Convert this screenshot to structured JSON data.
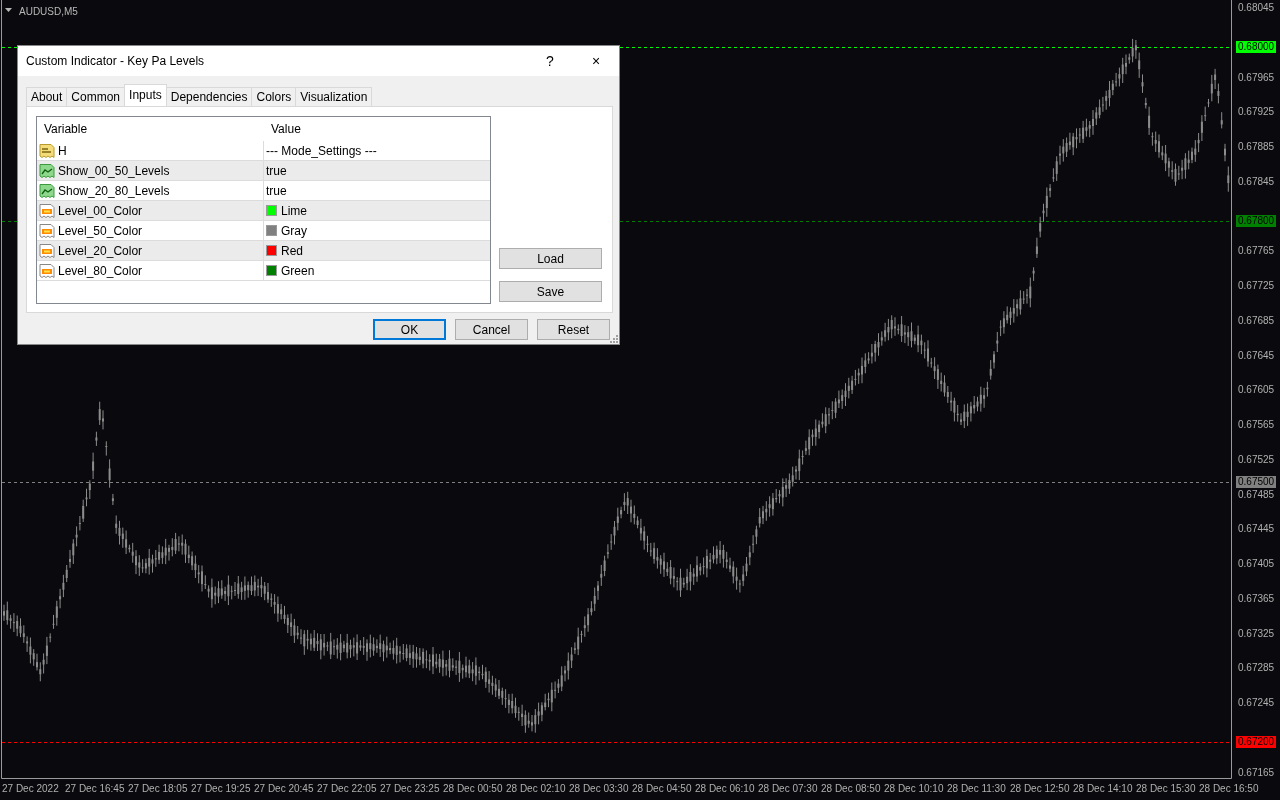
{
  "chart": {
    "symbol": "AUDUSD,M5",
    "price_axis": [
      {
        "label": "0.68045",
        "kind": "tick"
      },
      {
        "label": "0.68000",
        "kind": "level",
        "color": "#00ff00"
      },
      {
        "label": "0.67965",
        "kind": "tick"
      },
      {
        "label": "0.67925",
        "kind": "tick"
      },
      {
        "label": "0.67885",
        "kind": "tick"
      },
      {
        "label": "0.67845",
        "kind": "tick"
      },
      {
        "label": "0.67800",
        "kind": "level",
        "color": "#008000"
      },
      {
        "label": "0.67765",
        "kind": "tick"
      },
      {
        "label": "0.67725",
        "kind": "tick"
      },
      {
        "label": "0.67685",
        "kind": "tick"
      },
      {
        "label": "0.67645",
        "kind": "tick"
      },
      {
        "label": "0.67605",
        "kind": "tick"
      },
      {
        "label": "0.67565",
        "kind": "tick"
      },
      {
        "label": "0.67525",
        "kind": "tick"
      },
      {
        "label": "0.67500",
        "kind": "level",
        "color": "#808080"
      },
      {
        "label": "0.67485",
        "kind": "tick"
      },
      {
        "label": "0.67445",
        "kind": "tick"
      },
      {
        "label": "0.67405",
        "kind": "tick"
      },
      {
        "label": "0.67365",
        "kind": "tick"
      },
      {
        "label": "0.67325",
        "kind": "tick"
      },
      {
        "label": "0.67285",
        "kind": "tick"
      },
      {
        "label": "0.67245",
        "kind": "tick"
      },
      {
        "label": "0.67200",
        "kind": "level",
        "color": "#ff0000"
      },
      {
        "label": "0.67165",
        "kind": "tick"
      }
    ],
    "time_axis": [
      "27 Dec 2022",
      "27 Dec 16:45",
      "27 Dec 18:05",
      "27 Dec 19:25",
      "27 Dec 20:45",
      "27 Dec 22:05",
      "27 Dec 23:25",
      "28 Dec 00:50",
      "28 Dec 02:10",
      "28 Dec 03:30",
      "28 Dec 04:50",
      "28 Dec 06:10",
      "28 Dec 07:30",
      "28 Dec 08:50",
      "28 Dec 10:10",
      "28 Dec 11:30",
      "28 Dec 12:50",
      "28 Dec 14:10",
      "28 Dec 15:30",
      "28 Dec 16:50"
    ]
  },
  "dialog": {
    "title": "Custom Indicator - Key Pa Levels",
    "help": "?",
    "close": "×",
    "tabs": [
      {
        "label": "About",
        "selected": false
      },
      {
        "label": "Common",
        "selected": false
      },
      {
        "label": "Inputs",
        "selected": true
      },
      {
        "label": "Dependencies",
        "selected": false
      },
      {
        "label": "Colors",
        "selected": false
      },
      {
        "label": "Visualization",
        "selected": false
      }
    ],
    "table": {
      "columns": [
        "Variable",
        "Value"
      ],
      "rows": [
        {
          "kind": "string",
          "variable": "H",
          "value": "--- Mode_Settings ---"
        },
        {
          "kind": "bool",
          "variable": "Show_00_50_Levels",
          "value": "true"
        },
        {
          "kind": "bool",
          "variable": "Show_20_80_Levels",
          "value": "true"
        },
        {
          "kind": "color",
          "variable": "Level_00_Color",
          "value": "Lime",
          "color": "#00ff00"
        },
        {
          "kind": "color",
          "variable": "Level_50_Color",
          "value": "Gray",
          "color": "#808080"
        },
        {
          "kind": "color",
          "variable": "Level_20_Color",
          "value": "Red",
          "color": "#ff0000"
        },
        {
          "kind": "color",
          "variable": "Level_80_Color",
          "value": "Green",
          "color": "#008000"
        }
      ]
    },
    "side_buttons": [
      "Load",
      "Save"
    ],
    "buttons": [
      {
        "label": "OK",
        "default": true
      },
      {
        "label": "Cancel",
        "default": false
      },
      {
        "label": "Reset",
        "default": false
      }
    ]
  }
}
